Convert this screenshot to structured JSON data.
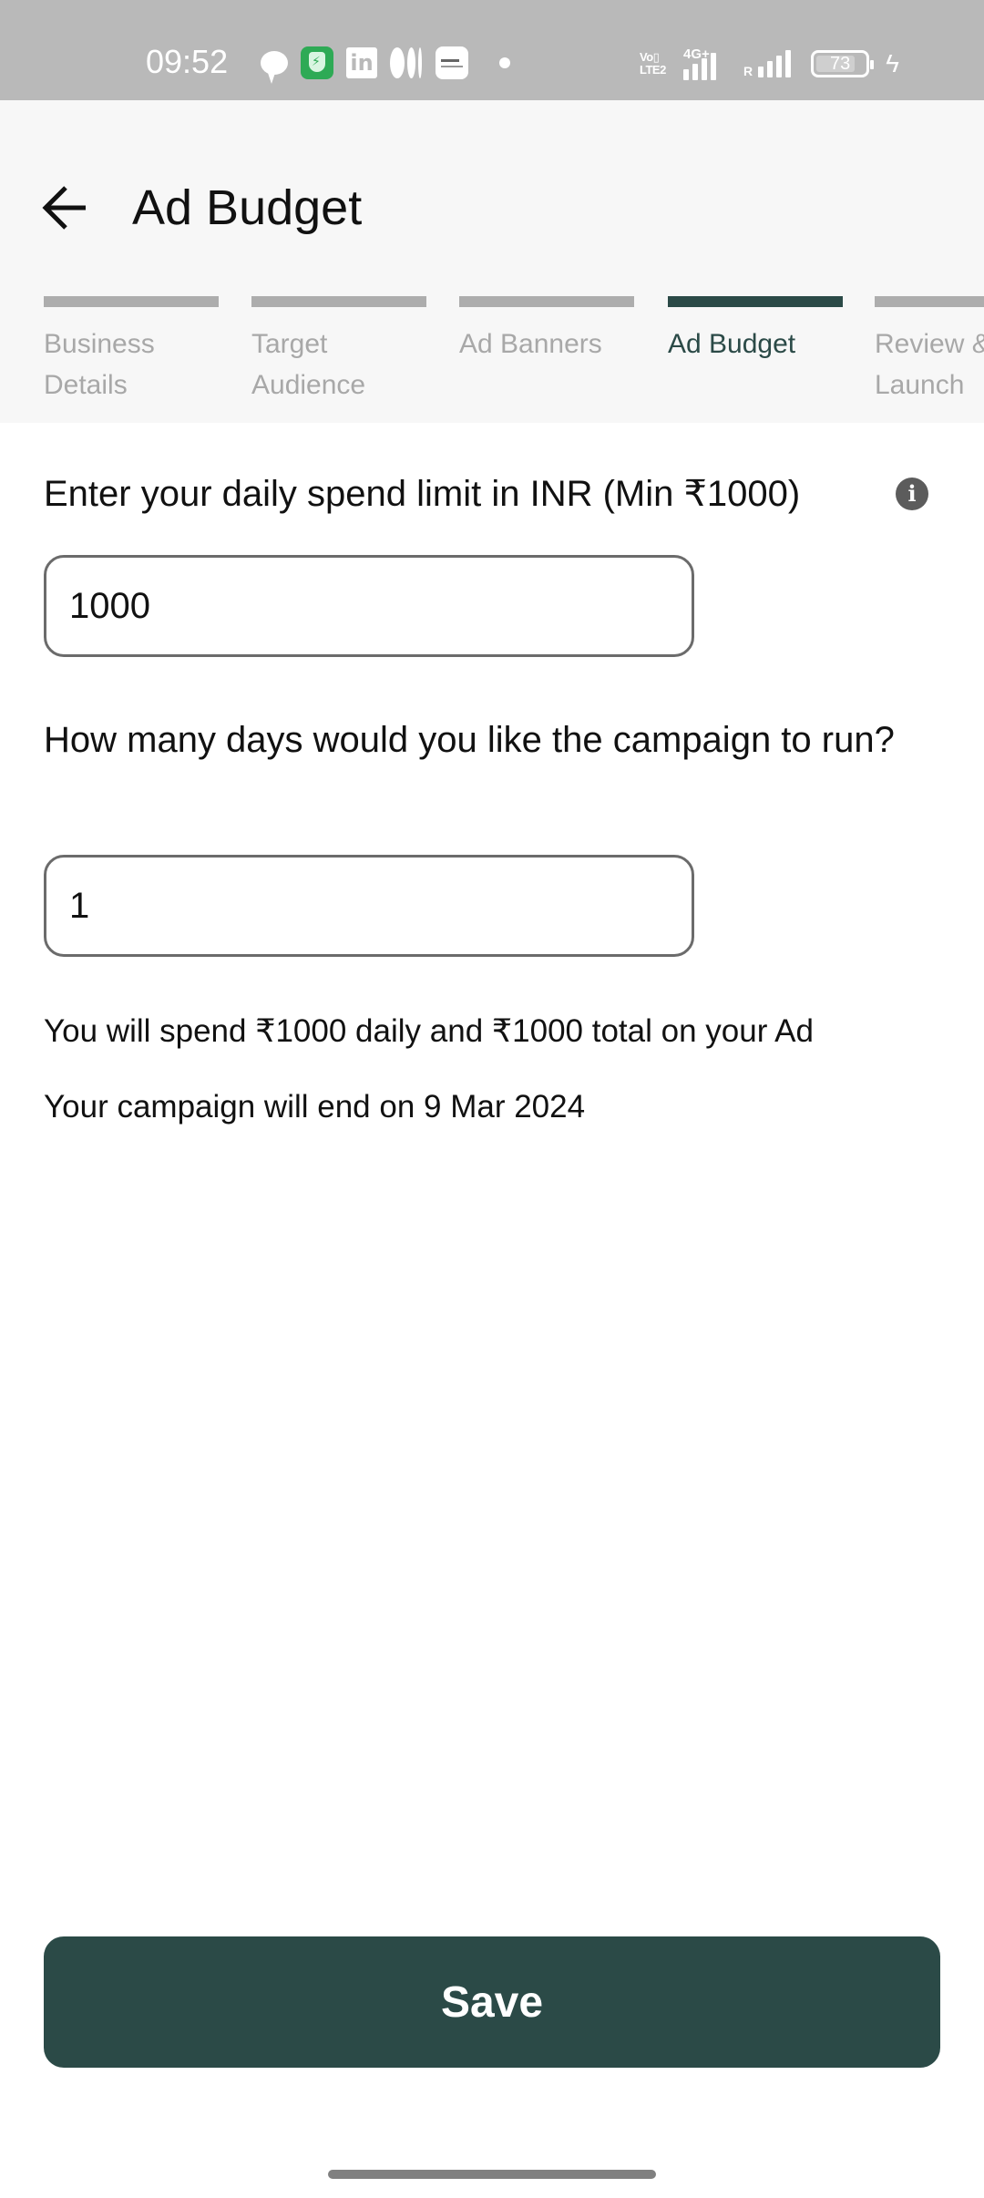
{
  "status_bar": {
    "time": "09:52",
    "left_icons": [
      "chat-bubble-icon",
      "security-shield-icon",
      "linkedin-icon",
      "medium-icon",
      "news-app-icon",
      "notification-dot-icon"
    ],
    "volte_label": "VoLTE",
    "network_label": "4G+",
    "roaming_label": "R",
    "battery_percent": "73",
    "charging": true
  },
  "header": {
    "back_icon": "arrow-left-icon",
    "title": "Ad Budget"
  },
  "stepper": {
    "steps": [
      {
        "label": "Business\nDetails",
        "state": "completed"
      },
      {
        "label": "Target\nAudience",
        "state": "completed"
      },
      {
        "label": "Ad Banners",
        "state": "completed"
      },
      {
        "label": "Ad Budget",
        "state": "active"
      },
      {
        "label": "Review &\nLaunch",
        "state": "pending"
      }
    ],
    "active_color": "#2b4a47",
    "inactive_color": "#adadad"
  },
  "form": {
    "daily_limit": {
      "label": "Enter your daily spend limit in INR (Min ₹1000)",
      "info_icon": "info-icon",
      "value": "1000"
    },
    "days": {
      "label": "How many days would you like the campaign to run?",
      "value": "1"
    },
    "summary_spend": "You will spend ₹1000 daily and ₹1000 total on your Ad",
    "summary_end": "Your campaign will end on 9 Mar 2024"
  },
  "actions": {
    "save_label": "Save",
    "primary_color": "#2b4a47"
  }
}
